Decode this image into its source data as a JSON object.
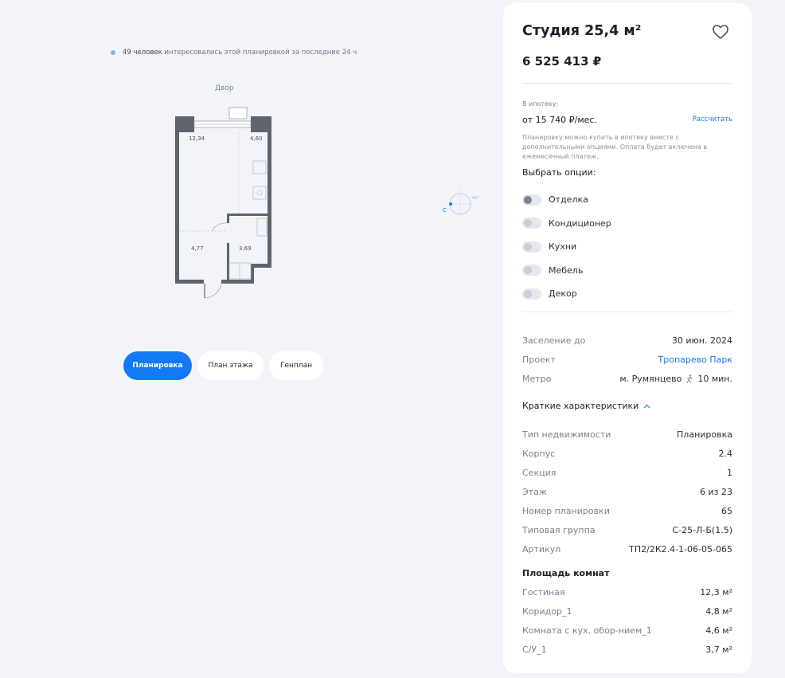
{
  "interest": {
    "count": "49 человек",
    "text": "интересовались этой планировкой за последние 24 ч"
  },
  "plan": {
    "yard_label": "Двор",
    "areas": [
      "12,34",
      "4,60",
      "4,77",
      "3,69"
    ]
  },
  "compass": {
    "label_c": "С",
    "label_deg": "40°"
  },
  "tabs": [
    "Планировка",
    "План этажа",
    "Генплан"
  ],
  "card": {
    "title": "Студия 25,4 м²",
    "price": "6 525 413 ₽",
    "mortgage": {
      "label": "В ипотеку:",
      "value": "от 15 740 ₽/мес.",
      "calc": "Рассчитать",
      "note": "Планировку можно купить в ипотеку вместе с дополнительными опциями. Оплата будет включена в ежемесячный платеж."
    },
    "options_title": "Выбрать опции:",
    "options": [
      {
        "label": "Отделка",
        "on": true
      },
      {
        "label": "Кондиционер",
        "on": false
      },
      {
        "label": "Кухни",
        "on": false
      },
      {
        "label": "Мебель",
        "on": false
      },
      {
        "label": "Декор",
        "on": false
      }
    ],
    "info": {
      "settle_k": "Заселение до",
      "settle_v": "30 июн. 2024",
      "project_k": "Проект",
      "project_v": "Тропарево Парк",
      "metro_k": "Метро",
      "metro_v": "м. Румянцево",
      "metro_time": "10 мин."
    },
    "brief_title": "Краткие характеристики",
    "specs": [
      {
        "k": "Тип недвижимости",
        "v": "Планировка"
      },
      {
        "k": "Корпус",
        "v": "2.4"
      },
      {
        "k": "Секция",
        "v": "1"
      },
      {
        "k": "Этаж",
        "v": "6 из 23"
      },
      {
        "k": "Номер планировки",
        "v": "65"
      },
      {
        "k": "Типовая группа",
        "v": "С-25-Л-Б(1.5)"
      },
      {
        "k": "Артикул",
        "v": "ТП2/2К2.4-1-06-05-065"
      }
    ],
    "rooms_title": "Площадь комнат",
    "rooms": [
      {
        "k": "Гостиная",
        "v": "12,3 м²"
      },
      {
        "k": "Коридор_1",
        "v": "4,8 м²"
      },
      {
        "k": "Комната с кух. обор-нием_1",
        "v": "4,6 м²"
      },
      {
        "k": "С/У_1",
        "v": "3,7 м²"
      }
    ]
  }
}
